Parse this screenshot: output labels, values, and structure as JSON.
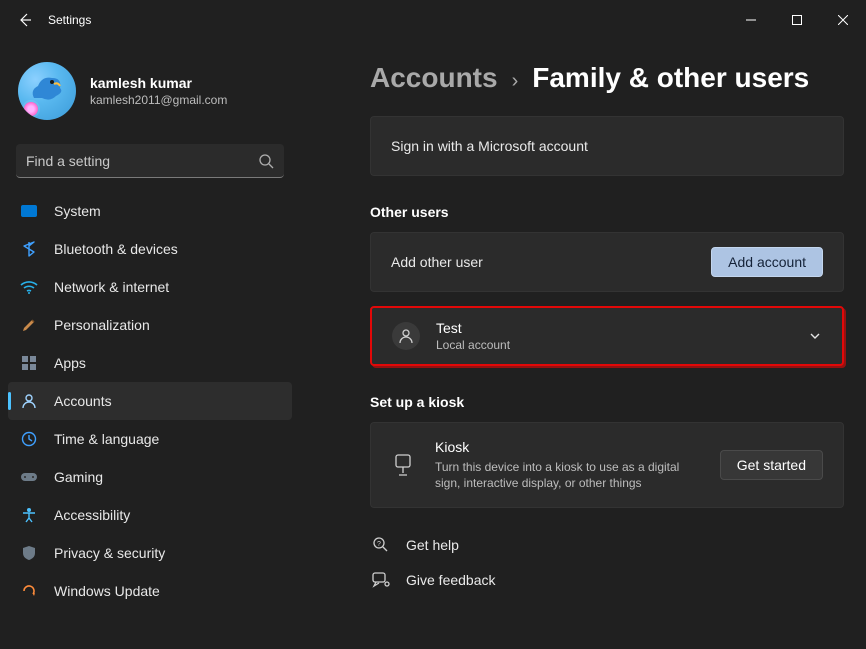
{
  "window": {
    "title": "Settings"
  },
  "profile": {
    "name": "kamlesh kumar",
    "email": "kamlesh2011@gmail.com"
  },
  "search": {
    "placeholder": "Find a setting"
  },
  "nav": {
    "items": [
      {
        "label": "System"
      },
      {
        "label": "Bluetooth & devices"
      },
      {
        "label": "Network & internet"
      },
      {
        "label": "Personalization"
      },
      {
        "label": "Apps"
      },
      {
        "label": "Accounts"
      },
      {
        "label": "Time & language"
      },
      {
        "label": "Gaming"
      },
      {
        "label": "Accessibility"
      },
      {
        "label": "Privacy & security"
      },
      {
        "label": "Windows Update"
      }
    ],
    "active_index": 5
  },
  "breadcrumb": {
    "parent": "Accounts",
    "current": "Family & other users"
  },
  "signin": {
    "text": "Sign in with a Microsoft account"
  },
  "sections": {
    "other_users": "Other users",
    "add_other_user_label": "Add other user",
    "add_account_button": "Add account",
    "user": {
      "name": "Test",
      "type": "Local account"
    },
    "kiosk_title": "Set up a kiosk",
    "kiosk": {
      "name": "Kiosk",
      "description": "Turn this device into a kiosk to use as a digital sign, interactive display, or other things",
      "button": "Get started"
    }
  },
  "footer": {
    "help": "Get help",
    "feedback": "Give feedback"
  }
}
